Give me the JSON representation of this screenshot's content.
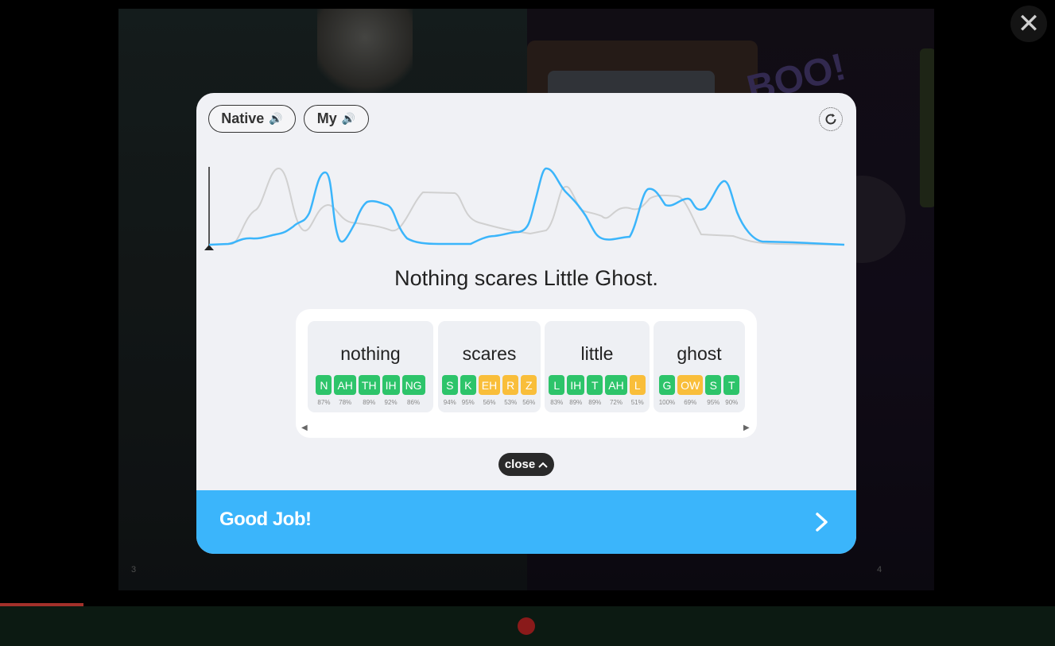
{
  "background": {
    "page_left_number": "3",
    "page_right_number": "4",
    "boo_text": "BOO!"
  },
  "window": {
    "close_icon": "close-icon"
  },
  "modal": {
    "native_label": "Native",
    "my_label": "My",
    "speaker_icon": "speaker-icon",
    "refresh_icon": "refresh-icon",
    "sentence": "Nothing scares Little Ghost.",
    "close_label": "close",
    "footer_text": "Good Job!",
    "colors": {
      "good": "#2dc46a",
      "mid": "#f9be3a",
      "native_wave": "#d0d0d0",
      "my_wave": "#3bb5fb",
      "footer": "#3bb5fb"
    },
    "words": [
      {
        "word": "nothing",
        "phonemes": [
          {
            "p": "N",
            "pct": "87%",
            "level": "good"
          },
          {
            "p": "AH",
            "pct": "78%",
            "level": "good"
          },
          {
            "p": "TH",
            "pct": "89%",
            "level": "good"
          },
          {
            "p": "IH",
            "pct": "92%",
            "level": "good"
          },
          {
            "p": "NG",
            "pct": "86%",
            "level": "good"
          }
        ]
      },
      {
        "word": "scares",
        "phonemes": [
          {
            "p": "S",
            "pct": "94%",
            "level": "good"
          },
          {
            "p": "K",
            "pct": "95%",
            "level": "good"
          },
          {
            "p": "EH",
            "pct": "56%",
            "level": "mid"
          },
          {
            "p": "R",
            "pct": "53%",
            "level": "mid"
          },
          {
            "p": "Z",
            "pct": "56%",
            "level": "mid"
          }
        ]
      },
      {
        "word": "little",
        "phonemes": [
          {
            "p": "L",
            "pct": "83%",
            "level": "good"
          },
          {
            "p": "IH",
            "pct": "89%",
            "level": "good"
          },
          {
            "p": "T",
            "pct": "89%",
            "level": "good"
          },
          {
            "p": "AH",
            "pct": "72%",
            "level": "good"
          },
          {
            "p": "L",
            "pct": "51%",
            "level": "mid"
          }
        ]
      },
      {
        "word": "ghost",
        "phonemes": [
          {
            "p": "G",
            "pct": "100%",
            "level": "good"
          },
          {
            "p": "OW",
            "pct": "69%",
            "level": "mid"
          },
          {
            "p": "S",
            "pct": "95%",
            "level": "good"
          },
          {
            "p": "T",
            "pct": "90%",
            "level": "good"
          }
        ]
      }
    ]
  }
}
